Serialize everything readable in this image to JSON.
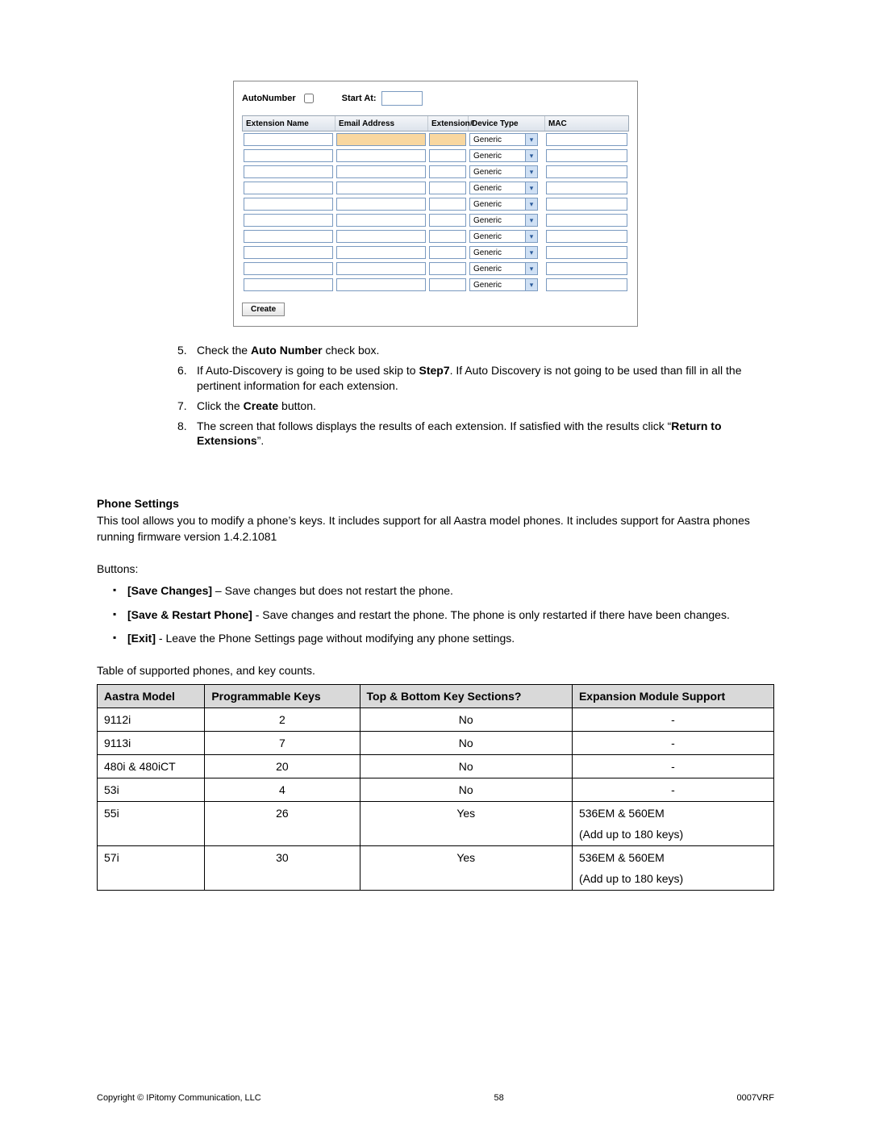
{
  "screenshot": {
    "autonumber_label": "AutoNumber",
    "startat_label": "Start At:",
    "columns": {
      "name": "Extension Name",
      "email": "Email Address",
      "ext": "Extension#",
      "device": "Device Type",
      "mac": "MAC"
    },
    "device_option": "Generic",
    "row_count": 10,
    "create_label": "Create"
  },
  "steps": [
    {
      "num": "5.",
      "html": "Check the <b>Auto Number</b> check box."
    },
    {
      "num": "6.",
      "html": " If Auto-Discovery is going to be used skip to <b>Step7</b>. If Auto Discovery is not going to be used than fill in all the pertinent information for each extension."
    },
    {
      "num": "7.",
      "html": "Click the <b>Create</b> button."
    },
    {
      "num": "8.",
      "html": "The screen that follows displays the results of each extension. If satisfied with the results click “<b>Return to Extensions</b>”."
    }
  ],
  "phone_settings": {
    "heading": "Phone Settings",
    "intro": "This tool allows you to modify a phone’s keys. It includes support for all Aastra model phones. It includes support for Aastra phones running firmware version 1.4.2.1081",
    "buttons_label": "Buttons:",
    "bullets": [
      "<b>[Save Changes]</b> – Save changes but does not restart the phone.",
      "<b>[Save & Restart Phone]</b> - Save changes and restart the phone. The phone is only restarted if there have been changes.",
      "<b>[Exit]</b> - Leave the Phone Settings page without modifying any phone settings."
    ],
    "table_caption": "Table of supported phones, and key counts."
  },
  "phones_table": {
    "headers": [
      "Aastra Model",
      "Programmable Keys",
      "Top & Bottom Key Sections?",
      "Expansion Module Support"
    ],
    "rows": [
      {
        "model": "9112i",
        "keys": "2",
        "sections": "No",
        "exp": "-"
      },
      {
        "model": "9113i",
        "keys": "7",
        "sections": "No",
        "exp": "-"
      },
      {
        "model": "480i & 480iCT",
        "keys": "20",
        "sections": "No",
        "exp": "-"
      },
      {
        "model": "53i",
        "keys": "4",
        "sections": "No",
        "exp": "-"
      },
      {
        "model": "55i",
        "keys": "26",
        "sections": "Yes",
        "exp": "536EM & 560EM\n(Add up to 180 keys)"
      },
      {
        "model": "57i",
        "keys": "30",
        "sections": "Yes",
        "exp": "536EM & 560EM\n(Add up to 180 keys)"
      }
    ]
  },
  "footer": {
    "left": "Copyright © IPitomy Communication, LLC",
    "center": "58",
    "right": "0007VRF"
  }
}
